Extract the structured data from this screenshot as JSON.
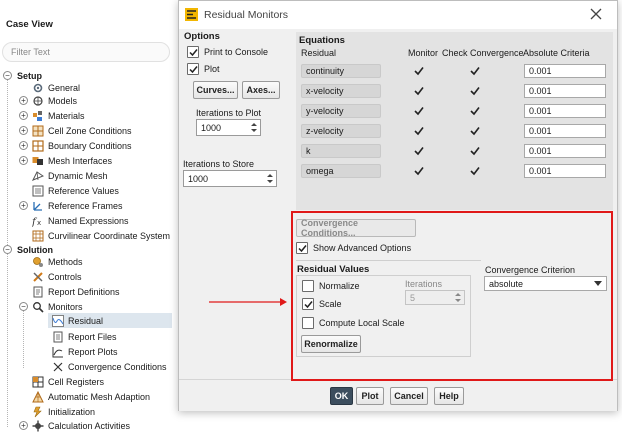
{
  "tree_panel": {
    "title": "Case View",
    "filter_placeholder": "Filter Text",
    "setup": {
      "label": "Setup",
      "items": [
        "General",
        "Models",
        "Materials",
        "Cell Zone Conditions",
        "Boundary Conditions",
        "Mesh Interfaces",
        "Dynamic Mesh",
        "Reference Values",
        "Reference Frames",
        "Named Expressions",
        "Curvilinear Coordinate System"
      ]
    },
    "solution": {
      "label": "Solution",
      "items": [
        "Methods",
        "Controls",
        "Report Definitions",
        "Monitors"
      ],
      "monitors_children": [
        "Residual",
        "Report Files",
        "Report Plots",
        "Convergence Conditions"
      ],
      "items_after": [
        "Cell Registers",
        "Automatic Mesh Adaption",
        "Initialization",
        "Calculation Activities"
      ]
    }
  },
  "dialog": {
    "title": "Residual Monitors",
    "options": {
      "title": "Options",
      "print_to_console": "Print to Console",
      "plot": "Plot",
      "curves_button": "Curves...",
      "axes_button": "Axes...",
      "iterations_to_plot_label": "Iterations to Plot",
      "iterations_to_plot_value": "1000",
      "iterations_to_store_label": "Iterations to Store",
      "iterations_to_store_value": "1000"
    },
    "equations": {
      "title": "Equations",
      "headers": {
        "residual": "Residual",
        "monitor": "Monitor",
        "check_convergence": "Check Convergence",
        "absolute_criteria": "Absolute Criteria"
      },
      "rows": [
        {
          "residual": "continuity",
          "criteria": "0.001"
        },
        {
          "residual": "x-velocity",
          "criteria": "0.001"
        },
        {
          "residual": "y-velocity",
          "criteria": "0.001"
        },
        {
          "residual": "z-velocity",
          "criteria": "0.001"
        },
        {
          "residual": "k",
          "criteria": "0.001"
        },
        {
          "residual": "omega",
          "criteria": "0.001"
        }
      ]
    },
    "convergence_conditions_button": "Convergence Conditions...",
    "show_advanced_options": "Show Advanced Options",
    "residual_values": {
      "title": "Residual Values",
      "normalize": "Normalize",
      "iterations_label": "Iterations",
      "iterations_value": "5",
      "scale": "Scale",
      "compute_local_scale": "Compute Local Scale",
      "renormalize_button": "Renormalize"
    },
    "convergence_criterion": {
      "label": "Convergence Criterion",
      "value": "absolute"
    },
    "buttons": {
      "ok": "OK",
      "plot": "Plot",
      "cancel": "Cancel",
      "help": "Help"
    }
  },
  "colors": {
    "annotation_red": "#e01919",
    "selected_row": "#dde6ee",
    "ok_button": "#3c4e5e"
  }
}
